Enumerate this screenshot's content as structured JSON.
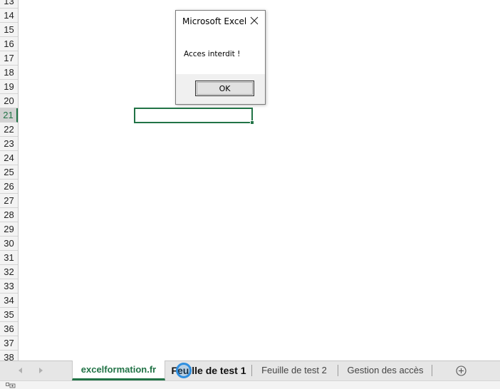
{
  "rows": [
    "13",
    "14",
    "15",
    "16",
    "17",
    "18",
    "19",
    "20",
    "21",
    "22",
    "23",
    "24",
    "25",
    "26",
    "27",
    "28",
    "29",
    "30",
    "31",
    "32",
    "33",
    "34",
    "35",
    "36",
    "37",
    "38"
  ],
  "active_row": "21",
  "dialog": {
    "title": "Microsoft Excel",
    "message": "Acces interdit !",
    "ok_label": "OK",
    "close_icon": "close-icon"
  },
  "sheet_tabs": {
    "tab1": "excelformation.fr",
    "tab2": "Feuille de test 1",
    "tab3": "Feuille de test 2",
    "tab4": "Gestion des accès"
  },
  "icons": {
    "nav_left": "triangle-left-icon",
    "nav_right": "triangle-right-icon",
    "add_sheet": "plus-circle-icon",
    "status": "macro-record-icon"
  },
  "colors": {
    "accent": "#217346",
    "cursor": "#2f8fe0"
  }
}
